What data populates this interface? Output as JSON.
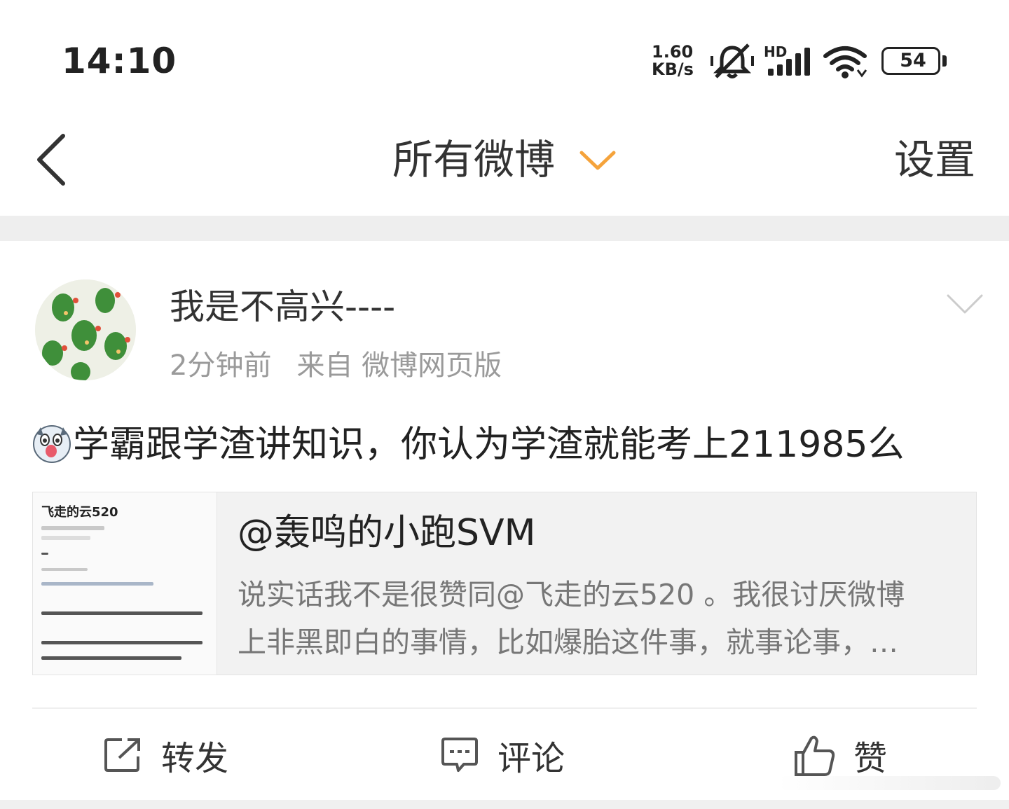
{
  "status_bar": {
    "time": "14:10",
    "net_speed_value": "1.60",
    "net_speed_unit": "KB/s",
    "hd_label": "HD",
    "battery": "54",
    "icons": [
      "mute-vibrate-icon",
      "signal-icon",
      "wifi-icon",
      "battery-icon"
    ]
  },
  "nav": {
    "title": "所有微博",
    "settings_label": "设置"
  },
  "post": {
    "username": "我是不高兴----",
    "time": "2分钟前",
    "source": "来自 微博网页版",
    "text": "学霸跟学渣讲知识，你认为学渣就能考上211985么"
  },
  "repost": {
    "author": "@轰鸣的小跑SVM",
    "text_line1": "说实话我不是很赞同@飞走的云520 。我很讨厌微博",
    "text_line2": "上非黑即白的事情，比如爆胎这件事，就事论事，…",
    "thumb_title": "飞走的云520"
  },
  "actions": {
    "repost_label": "转发",
    "comment_label": "评论",
    "like_label": "赞"
  },
  "colors": {
    "accent_orange": "#f5a33b",
    "text_primary": "#333333",
    "text_secondary": "#9a9a9a"
  }
}
